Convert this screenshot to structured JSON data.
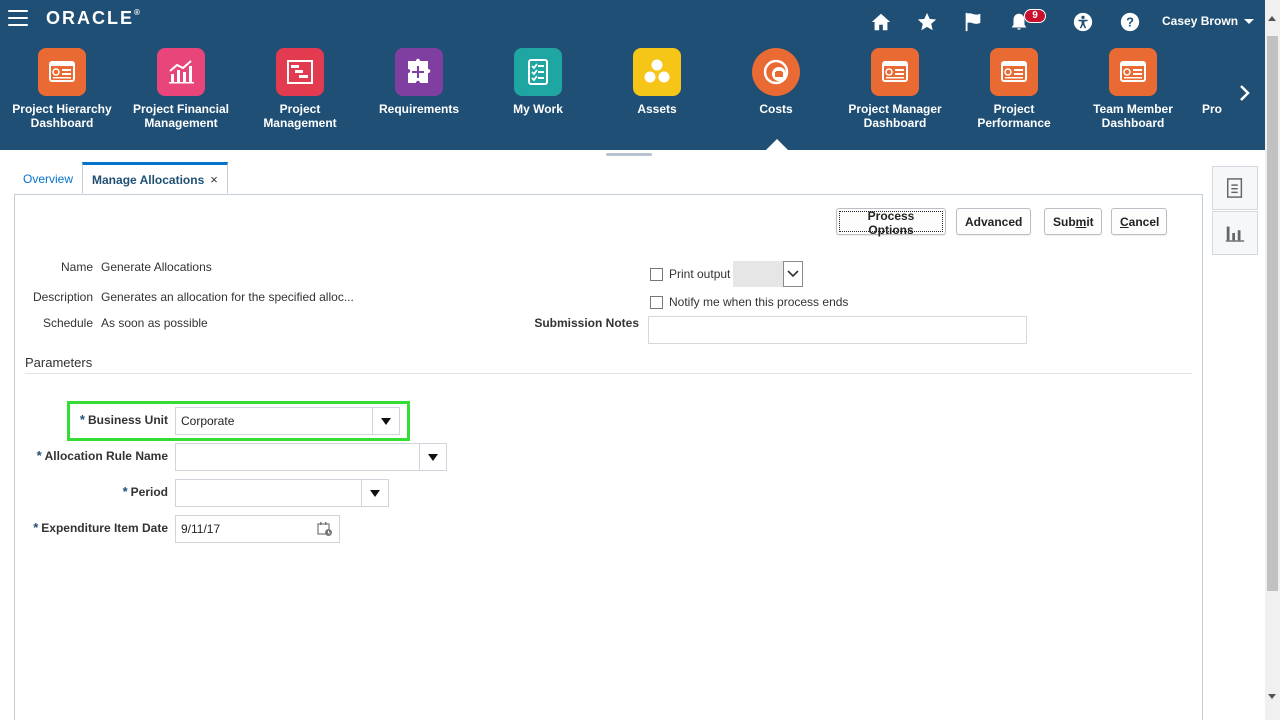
{
  "header": {
    "logo": "ORACLE",
    "logo_reg": "®",
    "notifications_count": "9",
    "user_name": "Casey Brown",
    "colors": {
      "header_bg": "#1f4f75",
      "badge": "#c8102e",
      "highlight": "#33dd33"
    }
  },
  "springboard": {
    "items": [
      {
        "label": "Project Hierarchy Dashboard",
        "icon": "dashboard-icon",
        "color": "#ea6a34"
      },
      {
        "label": "Project Financial Management",
        "icon": "bar-chart-icon",
        "color": "#e8457a"
      },
      {
        "label": "Project Management",
        "icon": "gantt-icon",
        "color": "#e23b4f"
      },
      {
        "label": "Requirements",
        "icon": "puzzle-icon",
        "color": "#7f3fa0"
      },
      {
        "label": "My Work",
        "icon": "checklist-icon",
        "color": "#1fa6a3"
      },
      {
        "label": "Assets",
        "icon": "assets-icon",
        "color": "#f5c518"
      },
      {
        "label": "Costs",
        "icon": "coins-icon",
        "color": "#ea6a34"
      },
      {
        "label": "Project Manager Dashboard",
        "icon": "dashboard-icon",
        "color": "#ea6a34"
      },
      {
        "label": "Project Performance Dashboard",
        "icon": "dashboard-icon",
        "color": "#ea6a34"
      },
      {
        "label": "Team Member Dashboard",
        "icon": "dashboard-icon",
        "color": "#ea6a34"
      },
      {
        "label": "Pro",
        "icon": "dashboard-icon",
        "color": "#ea6a34"
      }
    ]
  },
  "tabs": [
    {
      "label": "Overview"
    },
    {
      "label": "Manage Allocations",
      "close": "×"
    }
  ],
  "toolbar": {
    "process_options": "Process Options",
    "advanced": "Advanced",
    "submit_pre": "Sub",
    "submit_u": "m",
    "submit_post": "it",
    "cancel_u": "C",
    "cancel_post": "ancel"
  },
  "process": {
    "name_label": "Name",
    "name_value": "Generate Allocations",
    "description_label": "Description",
    "description_value": "Generates an allocation for the specified alloc...",
    "schedule_label": "Schedule",
    "schedule_value": "As soon as possible",
    "print_output_label": "Print output",
    "notify_label": "Notify me when this process ends",
    "submission_notes_label": "Submission Notes",
    "submission_notes_value": ""
  },
  "parameters": {
    "title": "Parameters",
    "required_mark": "*",
    "business_unit_label": "Business Unit",
    "business_unit_value": "Corporate",
    "allocation_rule_label": "Allocation Rule Name",
    "allocation_rule_value": "",
    "period_label": "Period",
    "period_value": "",
    "expenditure_date_label": "Expenditure Item Date",
    "expenditure_date_value": "9/11/17"
  }
}
